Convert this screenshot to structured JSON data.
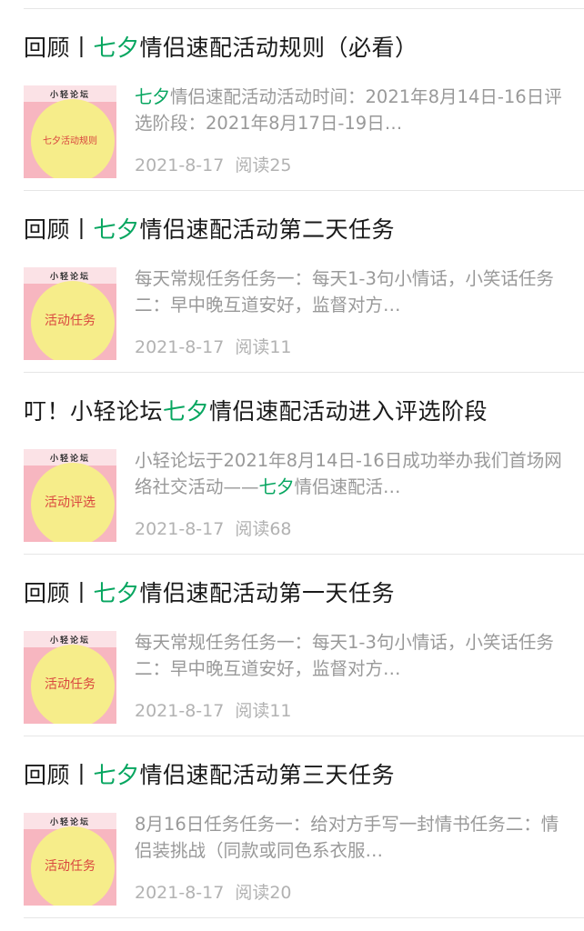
{
  "colors": {
    "highlight": "#07a660",
    "thumb_bg": "#f7b6c0",
    "thumb_circle": "#f6ed8a",
    "thumb_text": "#d9463e"
  },
  "articles": [
    {
      "title_pre": "回顾丨",
      "title_hl": "七夕",
      "title_post": "情侣速配活动规则（必看）",
      "thumb_brand": "小轻论坛",
      "thumb_label": "七夕活动规则",
      "excerpt_pre": "",
      "excerpt_hl": "七夕",
      "excerpt_post": "情侣速配活动活动时间：2021年8月14日-16日评选阶段：2021年8月17日-19日…",
      "date": "2021-8-17",
      "reads": "阅读25"
    },
    {
      "title_pre": "回顾丨",
      "title_hl": "七夕",
      "title_post": "情侣速配活动第二天任务",
      "thumb_brand": "小轻论坛",
      "thumb_label": "活动任务",
      "excerpt_pre": "每天常规任务任务一：每天1-3句小情话，小笑话任务二：早中晚互道安好，监督对方…",
      "excerpt_hl": "",
      "excerpt_post": "",
      "date": "2021-8-17",
      "reads": "阅读11"
    },
    {
      "title_pre": "叮！小轻论坛",
      "title_hl": "七夕",
      "title_post": "情侣速配活动进入评选阶段",
      "thumb_brand": "小轻论坛",
      "thumb_label": "活动评选",
      "excerpt_pre": "小轻论坛于2021年8月14日-16日成功举办我们首场网络社交活动——",
      "excerpt_hl": "七夕",
      "excerpt_post": "情侣速配活…",
      "date": "2021-8-17",
      "reads": "阅读68"
    },
    {
      "title_pre": "回顾丨",
      "title_hl": "七夕",
      "title_post": "情侣速配活动第一天任务",
      "thumb_brand": "小轻论坛",
      "thumb_label": "活动任务",
      "excerpt_pre": "每天常规任务任务一：每天1-3句小情话，小笑话任务二：早中晚互道安好，监督对方…",
      "excerpt_hl": "",
      "excerpt_post": "",
      "date": "2021-8-17",
      "reads": "阅读11"
    },
    {
      "title_pre": "回顾丨",
      "title_hl": "七夕",
      "title_post": "情侣速配活动第三天任务",
      "thumb_brand": "小轻论坛",
      "thumb_label": "活动任务",
      "excerpt_pre": "8月16日任务任务一：给对方手写一封情书任务二：情侣装挑战（同款或同色系衣服…",
      "excerpt_hl": "",
      "excerpt_post": "",
      "date": "2021-8-17",
      "reads": "阅读20"
    }
  ]
}
